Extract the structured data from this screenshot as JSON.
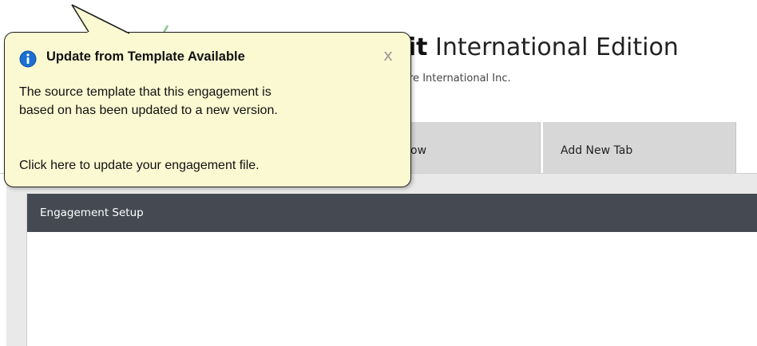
{
  "app": {
    "title_bold": "udit",
    "title_rest": "International Edition",
    "subtitle": "re International Inc."
  },
  "tabs": [
    {
      "label": "ow"
    },
    {
      "label": "Add New Tab"
    }
  ],
  "panel": {
    "header": "Engagement Setup"
  },
  "balloon": {
    "icon": "info-icon",
    "title": "Update from Template Available",
    "close_label": "x",
    "body_line1": "The source template that this engagement is",
    "body_line2": "based on has been updated to a new version.",
    "link_text": "Click here to update your engagement file."
  },
  "colors": {
    "balloon_bg": "#fbf9d2",
    "panel_header": "#454a52",
    "tab_bg": "#d7d7d7",
    "info_icon": "#1a6fd1"
  }
}
